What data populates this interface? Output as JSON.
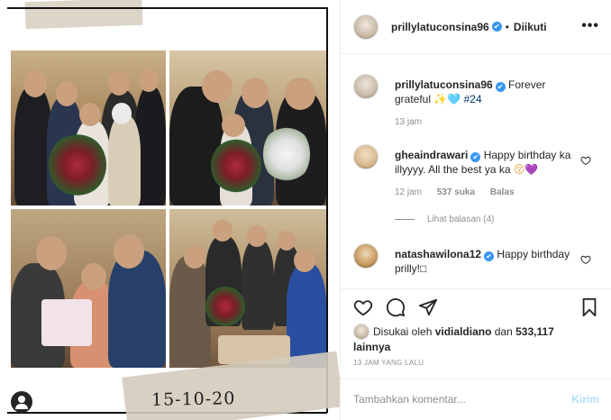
{
  "post": {
    "date_handwritten": "15-10-20"
  },
  "header": {
    "username": "prillylatuconsina96",
    "separator": "•",
    "follow_status": "Diikuti",
    "verified_mark": "✔"
  },
  "caption": {
    "username": "prillylatuconsina96",
    "text": "Forever grateful",
    "emoji": "✨🩵",
    "hashtag": "#24",
    "time": "13 jam"
  },
  "comments": [
    {
      "username": "gheaindrawari",
      "text": "Happy birthday ka illyyyy. All the best ya ka",
      "emoji_face": "😚",
      "emoji_heart": "💜",
      "time": "12 jam",
      "likes": "537 suka",
      "reply_label": "Balas",
      "view_replies": "Lihat balasan (4)"
    },
    {
      "username": "natashawilona12",
      "text": "Happy birthday prilly!",
      "emoji": "□"
    }
  ],
  "likes": {
    "prefix": "Disukai oleh",
    "liker": "vidialdiano",
    "connector": "dan",
    "others": "533,117 lainnya"
  },
  "post_time": "13 JAM YANG LALU",
  "comment_box": {
    "placeholder": "Tambahkan komentar...",
    "post_label": "Kirim"
  },
  "icons": {
    "more": "more-options-icon",
    "like": "heart-icon",
    "comment": "comment-icon",
    "share": "send-icon",
    "save": "bookmark-icon",
    "user_tag": "user-tag-icon"
  },
  "colors": {
    "verified": "#3897f0",
    "muted": "#8e8e8e",
    "post_button_disabled": "#b2dffc",
    "hashtag": "#00376b"
  }
}
